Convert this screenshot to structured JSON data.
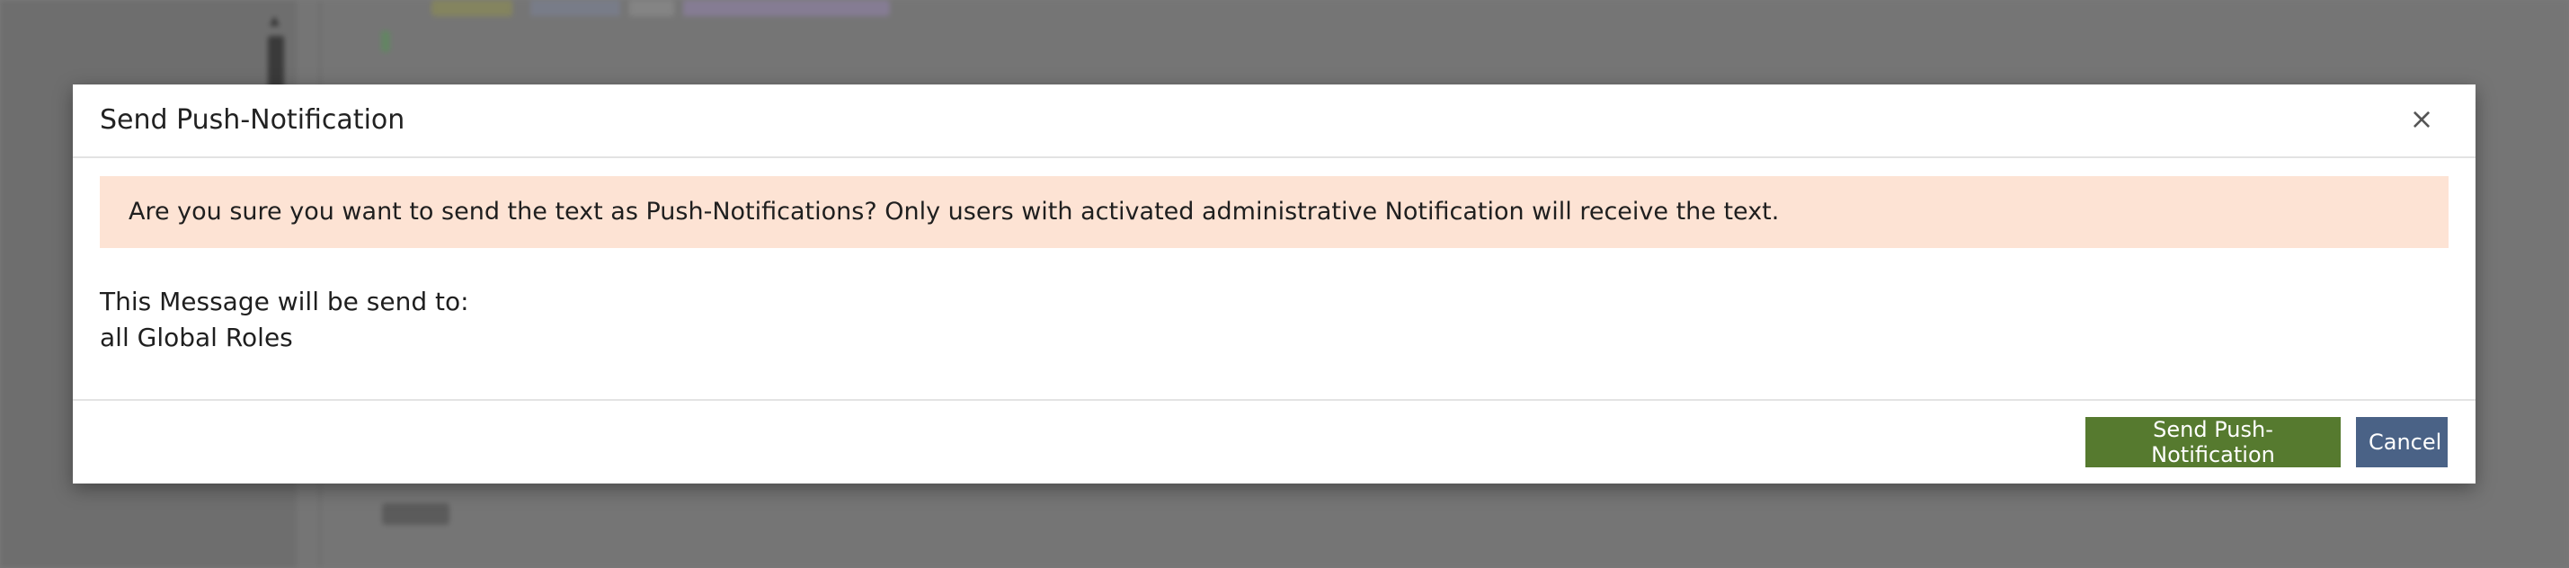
{
  "modal": {
    "title": "Send Push-Notification",
    "close_glyph": "×",
    "close_icon": "close-icon",
    "alert_text": "Are you sure you want to send the text as Push-Notifications? Only users with activated administrative Notification will receive the text.",
    "recipients_label": "This Message will be send to:",
    "recipients_value": "all Global Roles",
    "send_label": "Send Push-Notification",
    "cancel_label": "Cancel"
  },
  "colors": {
    "overlay": "#757575",
    "alert_background": "#fde3d4",
    "send_button": "#567a2f",
    "cancel_button": "#4a6286"
  }
}
